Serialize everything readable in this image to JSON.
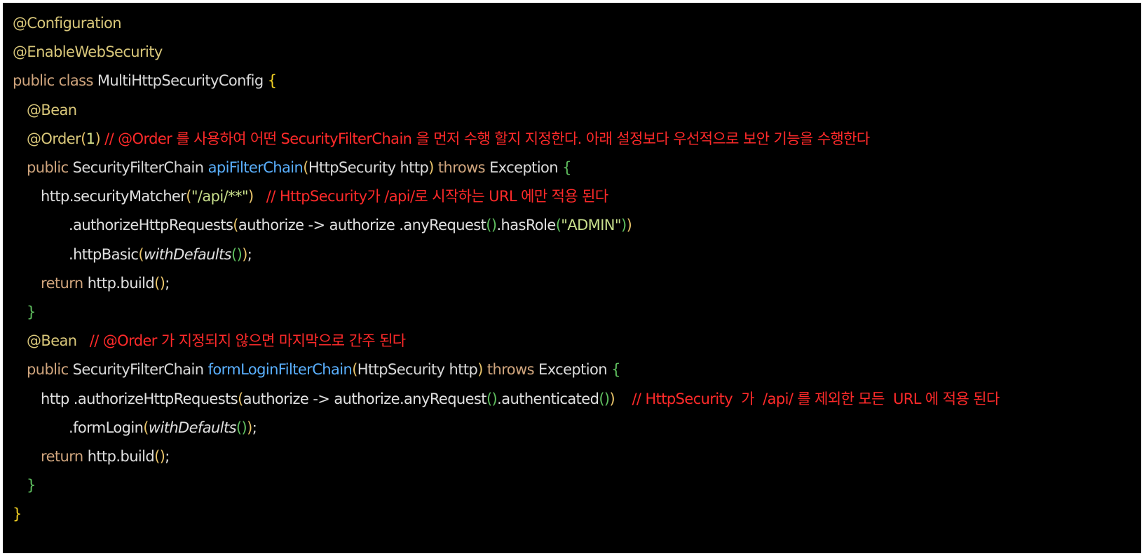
{
  "code": {
    "lines": [
      {
        "indent": 0,
        "tokens": [
          {
            "t": "@Configuration",
            "c": "ann"
          }
        ]
      },
      {
        "indent": 0,
        "tokens": [
          {
            "t": "@EnableWebSecurity",
            "c": "ann"
          }
        ]
      },
      {
        "indent": 0,
        "tokens": [
          {
            "t": "public class ",
            "c": "kw"
          },
          {
            "t": "MultiHttpSecurityConfig ",
            "c": "typ"
          },
          {
            "t": "{",
            "c": "br1"
          }
        ]
      },
      {
        "indent": 1,
        "tokens": [
          {
            "t": "@Bean",
            "c": "ann"
          }
        ]
      },
      {
        "indent": 1,
        "tokens": [
          {
            "t": "@Order",
            "c": "ann"
          },
          {
            "t": "(",
            "c": "br2"
          },
          {
            "t": "1",
            "c": "num"
          },
          {
            "t": ") ",
            "c": "br2"
          },
          {
            "t": "// @Order 를 사용하여 어떤 SecurityFilterChain 을 먼저 수행 할지 지정한다. 아래 설정보다 우선적으로 보안 기능을 수행한다",
            "c": "cmt"
          }
        ]
      },
      {
        "indent": 1,
        "tokens": [
          {
            "t": "public ",
            "c": "kw"
          },
          {
            "t": "SecurityFilterChain ",
            "c": "typ"
          },
          {
            "t": "apiFilterChain",
            "c": "mth"
          },
          {
            "t": "(",
            "c": "br2"
          },
          {
            "t": "HttpSecurity http",
            "c": "typ"
          },
          {
            "t": ") ",
            "c": "br2"
          },
          {
            "t": "throws ",
            "c": "kw"
          },
          {
            "t": "Exception ",
            "c": "typ"
          },
          {
            "t": "{",
            "c": "br3"
          }
        ]
      },
      {
        "indent": 2,
        "tokens": [
          {
            "t": "http.securityMatcher",
            "c": "txt"
          },
          {
            "t": "(",
            "c": "br2"
          },
          {
            "t": "\"/api/**\"",
            "c": "str"
          },
          {
            "t": ")   ",
            "c": "br2"
          },
          {
            "t": "// HttpSecurity가 /api/로 시작하는 URL 에만 적용 된다",
            "c": "cmt"
          }
        ]
      },
      {
        "indent": 4,
        "tokens": [
          {
            "t": ".authorizeHttpRequests",
            "c": "txt"
          },
          {
            "t": "(",
            "c": "br2"
          },
          {
            "t": "authorize -> authorize .anyRequest",
            "c": "txt"
          },
          {
            "t": "()",
            "c": "br3"
          },
          {
            "t": ".hasRole",
            "c": "txt"
          },
          {
            "t": "(",
            "c": "br3"
          },
          {
            "t": "\"ADMIN\"",
            "c": "str"
          },
          {
            "t": ")",
            "c": "br3"
          },
          {
            "t": ")",
            "c": "br2"
          }
        ]
      },
      {
        "indent": 4,
        "tokens": [
          {
            "t": ".httpBasic",
            "c": "txt"
          },
          {
            "t": "(",
            "c": "br2"
          },
          {
            "t": "withDefaults",
            "c": "it"
          },
          {
            "t": "()",
            "c": "br3"
          },
          {
            "t": ")",
            "c": "br2"
          },
          {
            "t": ";",
            "c": "txt"
          }
        ]
      },
      {
        "indent": 2,
        "tokens": [
          {
            "t": "return ",
            "c": "kw"
          },
          {
            "t": "http.build",
            "c": "txt"
          },
          {
            "t": "()",
            "c": "br2"
          },
          {
            "t": ";",
            "c": "txt"
          }
        ]
      },
      {
        "indent": 1,
        "tokens": [
          {
            "t": "}",
            "c": "br3"
          }
        ]
      },
      {
        "indent": 1,
        "tokens": [
          {
            "t": "@Bean   ",
            "c": "ann"
          },
          {
            "t": "// @Order 가 지정되지 않으면 마지막으로 간주 된다",
            "c": "cmt"
          }
        ]
      },
      {
        "indent": 1,
        "tokens": [
          {
            "t": "public ",
            "c": "kw"
          },
          {
            "t": "SecurityFilterChain ",
            "c": "typ"
          },
          {
            "t": "formLoginFilterChain",
            "c": "mth"
          },
          {
            "t": "(",
            "c": "br2"
          },
          {
            "t": "HttpSecurity http",
            "c": "typ"
          },
          {
            "t": ") ",
            "c": "br2"
          },
          {
            "t": "throws ",
            "c": "kw"
          },
          {
            "t": "Exception ",
            "c": "typ"
          },
          {
            "t": "{",
            "c": "br3"
          }
        ]
      },
      {
        "indent": 2,
        "tokens": [
          {
            "t": "http .authorizeHttpRequests",
            "c": "txt"
          },
          {
            "t": "(",
            "c": "br2"
          },
          {
            "t": "authorize -> authorize.anyRequest",
            "c": "txt"
          },
          {
            "t": "()",
            "c": "br3"
          },
          {
            "t": ".authenticated",
            "c": "txt"
          },
          {
            "t": "()",
            "c": "br3"
          },
          {
            "t": ")    ",
            "c": "br2"
          },
          {
            "t": "// HttpSecurity  가  /api/ 를 제외한 모든  URL 에 적용 된다",
            "c": "cmt"
          }
        ]
      },
      {
        "indent": 4,
        "tokens": [
          {
            "t": ".formLogin",
            "c": "txt"
          },
          {
            "t": "(",
            "c": "br2"
          },
          {
            "t": "withDefaults",
            "c": "it"
          },
          {
            "t": "()",
            "c": "br3"
          },
          {
            "t": ")",
            "c": "br2"
          },
          {
            "t": ";",
            "c": "txt"
          }
        ]
      },
      {
        "indent": 2,
        "tokens": [
          {
            "t": "return ",
            "c": "kw"
          },
          {
            "t": "http.build",
            "c": "txt"
          },
          {
            "t": "()",
            "c": "br2"
          },
          {
            "t": ";",
            "c": "txt"
          }
        ]
      },
      {
        "indent": 1,
        "tokens": [
          {
            "t": "}",
            "c": "br3"
          }
        ]
      },
      {
        "indent": 0,
        "tokens": [
          {
            "t": "}",
            "c": "br1"
          }
        ]
      }
    ]
  }
}
